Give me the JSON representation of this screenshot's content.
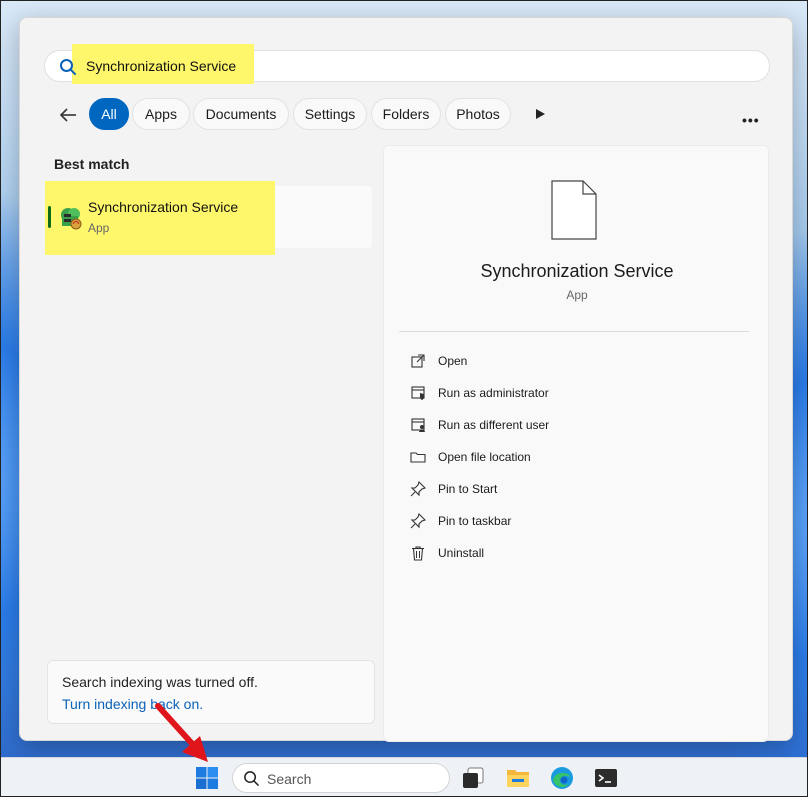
{
  "search": {
    "query": "Synchronization Service"
  },
  "filters": {
    "items": [
      {
        "label": "All",
        "active": true
      },
      {
        "label": "Apps"
      },
      {
        "label": "Documents"
      },
      {
        "label": "Settings"
      },
      {
        "label": "Folders"
      },
      {
        "label": "Photos"
      }
    ]
  },
  "results": {
    "section_title": "Best match",
    "best_match": {
      "title": "Synchronization Service",
      "subtitle": "App"
    }
  },
  "detail": {
    "title": "Synchronization Service",
    "subtitle": "App",
    "actions": [
      {
        "label": "Open",
        "icon": "open-icon"
      },
      {
        "label": "Run as administrator",
        "icon": "shield-icon"
      },
      {
        "label": "Run as different user",
        "icon": "user-icon"
      },
      {
        "label": "Open file location",
        "icon": "folder-icon"
      },
      {
        "label": "Pin to Start",
        "icon": "pin-icon"
      },
      {
        "label": "Pin to taskbar",
        "icon": "pin-icon"
      },
      {
        "label": "Uninstall",
        "icon": "trash-icon"
      }
    ]
  },
  "indexing": {
    "message": "Search indexing was turned off.",
    "link": "Turn indexing back on."
  },
  "taskbar": {
    "search_placeholder": "Search",
    "icons": [
      "windows-start-icon",
      "search-icon",
      "task-view-icon",
      "file-explorer-icon",
      "edge-icon",
      "terminal-icon"
    ]
  },
  "colors": {
    "accent": "#0067c0",
    "highlight": "#fff76b",
    "annotation_arrow": "#e0141b"
  }
}
